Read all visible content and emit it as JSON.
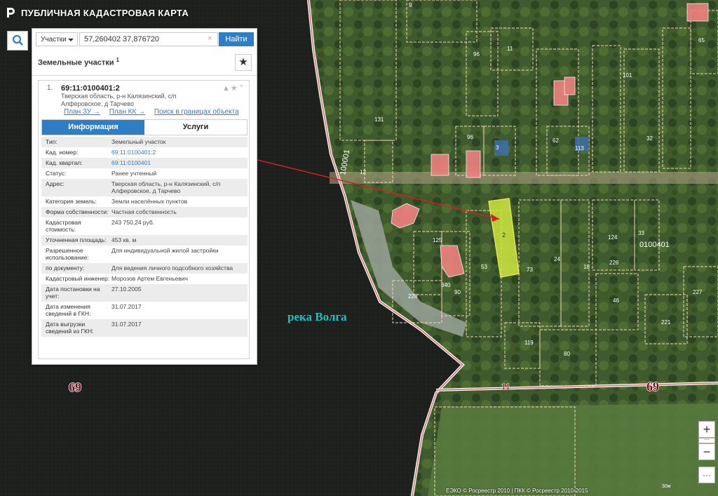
{
  "header": {
    "title": "ПУБЛИЧНАЯ КАДАСТРОВАЯ КАРТА"
  },
  "search": {
    "type_label": "Участки",
    "query": "57,260402 37,876720",
    "find_label": "Найти",
    "clear": "×"
  },
  "results": {
    "section_title": "Земельные участки",
    "count": "1",
    "item": {
      "index": "1.",
      "cad_number": "69:11:0100401:2",
      "address_line1": "Тверская область, р-н Калязинский, с/п",
      "address_line2": "Алферовское, д Тарчево",
      "links": [
        "План ЗУ →",
        "План КК →",
        "Поиск в границах объекта →"
      ],
      "tabs": [
        "Информация",
        "Услуги"
      ],
      "info": [
        {
          "k": "Тип:",
          "v": "Земельный участок"
        },
        {
          "k": "Кад. номер:",
          "v": "69:11:0100401:2"
        },
        {
          "k": "Кад. квартал:",
          "v": "69:11:0100401"
        },
        {
          "k": "Статус:",
          "v": "Ранее учтенный"
        },
        {
          "k": "Адрес:",
          "v": "Тверская область, р-н Калязинский, с/п Алферовское, д Тарчево"
        },
        {
          "k": "Категория земель:",
          "v": "Земли населённых пунктов"
        },
        {
          "k": "Форма собственности:",
          "v": "Частная собственность"
        },
        {
          "k": "Кадастровая стоимость:",
          "v": "243 750,24 руб."
        },
        {
          "k": "Уточненная площадь:",
          "v": "453 кв. м"
        },
        {
          "k": "Разрешенное использование:",
          "v": "Для индивидуальной жилой застройки"
        },
        {
          "k": "по документу:",
          "v": "Для ведения личного подсобного хозяйства"
        },
        {
          "k": "Кадастровый инженер:",
          "v": "Морозов Артем Евгеньевич"
        },
        {
          "k": "Дата постановки на учет:",
          "v": "27.10.2005"
        },
        {
          "k": "Дата изменения сведений в ГКН:",
          "v": "31.07.2017"
        },
        {
          "k": "Дата выгрузки сведений из ГКН:",
          "v": "31.07.2017"
        }
      ]
    }
  },
  "map": {
    "river_label": "река Волга",
    "region_labels": [
      "69",
      "69"
    ],
    "road_label": "11",
    "block_label": "0100401",
    "road_vertical_label": "100001",
    "selected_parcel_label": "2",
    "parcel_numbers": [
      "96",
      "11",
      "131",
      "9",
      "96",
      "3",
      "62",
      "113",
      "53",
      "101",
      "32",
      "65",
      "125",
      "73",
      "24",
      "18",
      "124",
      "33",
      "226",
      "340",
      "90",
      "228",
      "46",
      "221",
      "227",
      "119",
      "80",
      "12"
    ],
    "colors": {
      "selected": "#cfe640",
      "building": "#f08080",
      "boundary": "#f3d6b8",
      "arrow": "#d42020",
      "river_label": "#1fc1c6"
    }
  },
  "controls": {
    "zoom_in": "+",
    "zoom_out": "−",
    "more": "···"
  },
  "attribution": "ЕЭКО © Росреестр 2010 | ПКК © Росреестр 2010-2015",
  "scale": "30м"
}
